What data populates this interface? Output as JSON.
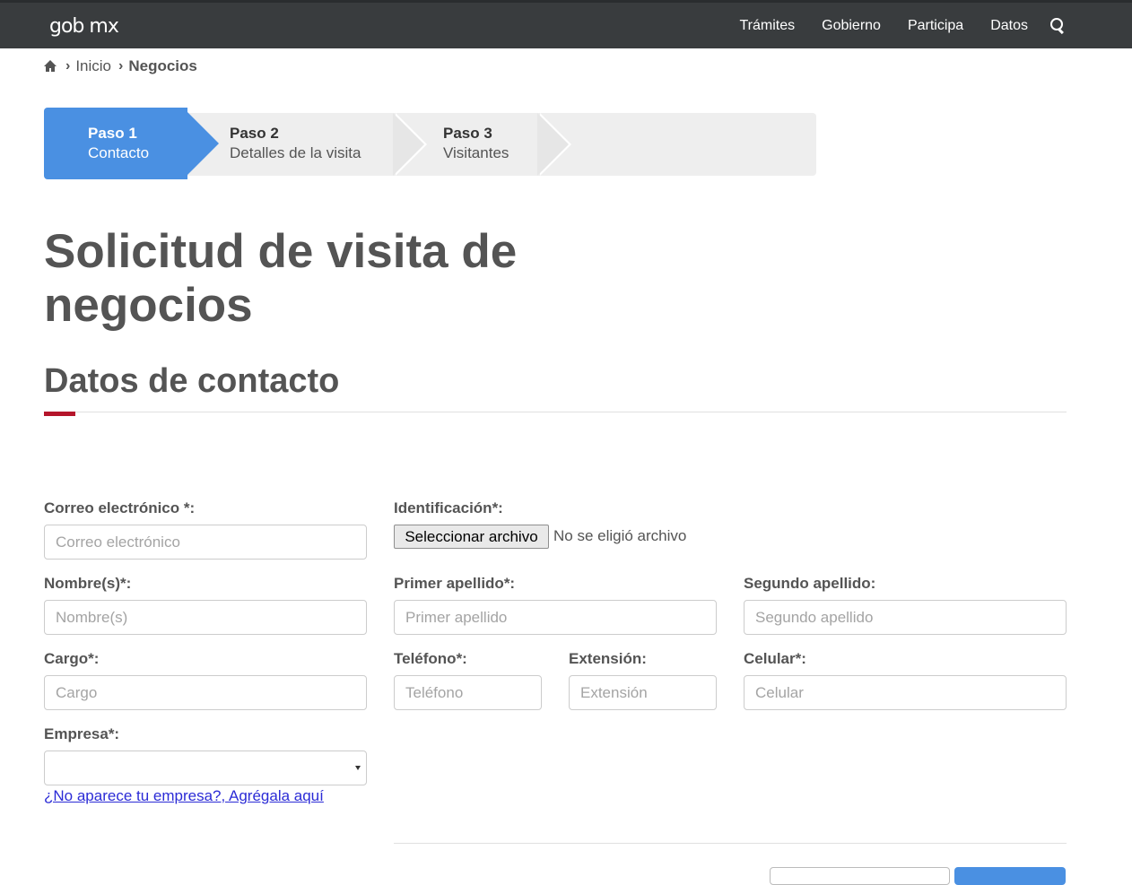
{
  "topbar": {
    "logo": "gob mx",
    "nav": [
      "Trámites",
      "Gobierno",
      "Participa",
      "Datos"
    ],
    "search_icon": "search-icon"
  },
  "breadcrumb": {
    "home_icon": "home-icon",
    "items": [
      "Inicio",
      "Negocios"
    ]
  },
  "stepper": {
    "steps": [
      {
        "title": "Paso 1",
        "subtitle": "Contacto"
      },
      {
        "title": "Paso 2",
        "subtitle": "Detalles de la visita"
      },
      {
        "title": "Paso 3",
        "subtitle": "Visitantes"
      }
    ],
    "active_index": 0,
    "active_color": "#4a90e2"
  },
  "page": {
    "title": "Solicitud de visita de negocios",
    "section_title": "Datos de contacto",
    "accent_color": "#b5152b"
  },
  "form": {
    "email": {
      "label": "Correo electrónico *:",
      "placeholder": "Correo electrónico"
    },
    "identificacion": {
      "label": "Identificación*:",
      "button": "Seleccionar archivo",
      "status": "No se eligió archivo"
    },
    "nombre": {
      "label": "Nombre(s)*:",
      "placeholder": "Nombre(s)"
    },
    "primer_apellido": {
      "label": "Primer apellido*:",
      "placeholder": "Primer apellido"
    },
    "segundo_apellido": {
      "label": "Segundo apellido:",
      "placeholder": "Segundo apellido"
    },
    "cargo": {
      "label": "Cargo*:",
      "placeholder": "Cargo"
    },
    "telefono": {
      "label": "Teléfono*:",
      "placeholder": "Teléfono"
    },
    "extension": {
      "label": "Extensión:",
      "placeholder": "Extensión"
    },
    "celular": {
      "label": "Celular*:",
      "placeholder": "Celular"
    },
    "empresa": {
      "label": "Empresa*:",
      "value": ""
    },
    "add_company_link": "¿No aparece tu empresa?, Agrégala aquí"
  }
}
